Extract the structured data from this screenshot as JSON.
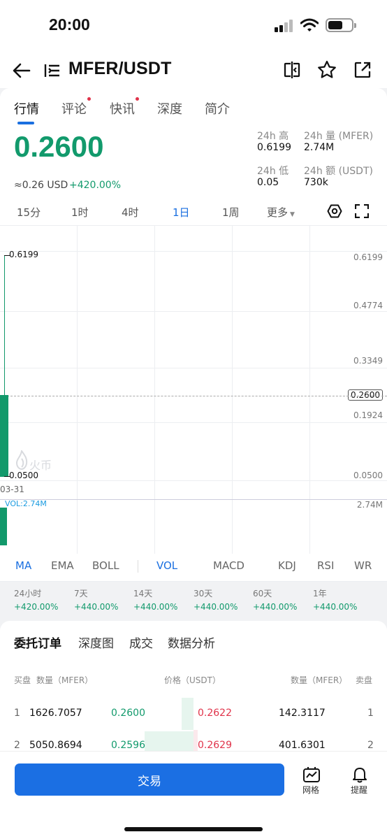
{
  "status": {
    "time": "20:00"
  },
  "header": {
    "pair": "MFER/USDT"
  },
  "tabs": [
    "行情",
    "评论",
    "快讯",
    "深度",
    "简介"
  ],
  "ticker": {
    "price": "0.2600",
    "approx": "≈0.26 USD",
    "change": "+420.00%",
    "high_label": "24h 高",
    "high_value": "0.6199",
    "vol_label": "24h 量 (MFER)",
    "vol_value": "2.74M",
    "low_label": "24h 低",
    "low_value": "0.05",
    "amount_label": "24h 额 (USDT)",
    "amount_value": "730k"
  },
  "intervals": [
    "15分",
    "1时",
    "4时",
    "1日",
    "1周",
    "更多"
  ],
  "chart": {
    "high_tag": "0.6199",
    "low_tag": "0.0500",
    "axis": [
      "0.6199",
      "0.4774",
      "0.3349",
      "0.2600",
      "0.1924",
      "0.0500"
    ],
    "date": "03-31",
    "watermark": "火币",
    "vol_label": "VOL:2.74M",
    "vol_axis": "2.74M"
  },
  "chart_data": {
    "type": "candlestick",
    "x": [
      "03-31"
    ],
    "open": [
      0.05
    ],
    "high": [
      0.6199
    ],
    "low": [
      0.05
    ],
    "close": [
      0.26
    ],
    "volume": [
      2740000
    ],
    "ylim": [
      0.05,
      0.6199
    ]
  },
  "indicators": [
    "MA",
    "EMA",
    "BOLL",
    "VOL",
    "MACD",
    "KDJ",
    "RSI",
    "WR"
  ],
  "performance": [
    {
      "label": "24小时",
      "value": "+420.00%"
    },
    {
      "label": "7天",
      "value": "+440.00%"
    },
    {
      "label": "14天",
      "value": "+440.00%"
    },
    {
      "label": "30天",
      "value": "+440.00%"
    },
    {
      "label": "60天",
      "value": "+440.00%"
    },
    {
      "label": "1年",
      "value": "+440.00%"
    }
  ],
  "orderbook": {
    "tabs": [
      "委托订单",
      "深度图",
      "成交",
      "数据分析"
    ],
    "headers": {
      "buy": "买盘",
      "qty_left": "数量（MFER）",
      "price": "价格（USDT）",
      "qty_right": "数量（MFER）",
      "sell": "卖盘"
    },
    "rows": [
      {
        "n": "1",
        "bid_qty": "1626.7057",
        "bid_price": "0.2600",
        "ask_price": "0.2622",
        "ask_qty": "142.3117",
        "m": "1"
      },
      {
        "n": "2",
        "bid_qty": "5050.8694",
        "bid_price": "0.2596",
        "ask_price": "0.2629",
        "ask_qty": "401.6301",
        "m": "2"
      }
    ]
  },
  "bottom": {
    "trade": "交易",
    "grid": "网格",
    "alert": "提醒"
  }
}
